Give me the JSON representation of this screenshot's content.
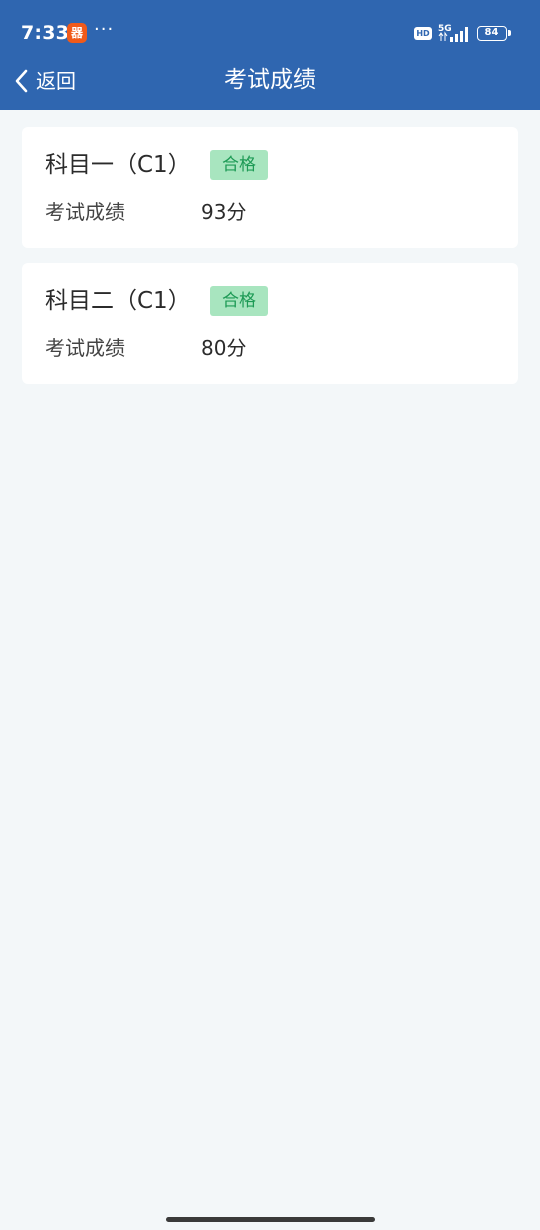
{
  "status_bar": {
    "time": "7:33",
    "app_badge": "器",
    "more": "···",
    "hd": "HD",
    "network": "5G",
    "battery": "84"
  },
  "header": {
    "back_label": "返回",
    "title": "考试成绩"
  },
  "results": [
    {
      "subject": "科目一（C1）",
      "status": "合格",
      "score_label": "考试成绩",
      "score": "93分"
    },
    {
      "subject": "科目二（C1）",
      "status": "合格",
      "score_label": "考试成绩",
      "score": "80分"
    }
  ],
  "colors": {
    "header_bg": "#2f66b0",
    "page_bg": "#f3f7f9",
    "pass_badge_bg": "#a8e5bf",
    "pass_badge_text": "#1d9a55"
  },
  "icons": {
    "back": "chevron-left-icon",
    "signal": "signal-bars-icon",
    "battery": "battery-icon"
  }
}
